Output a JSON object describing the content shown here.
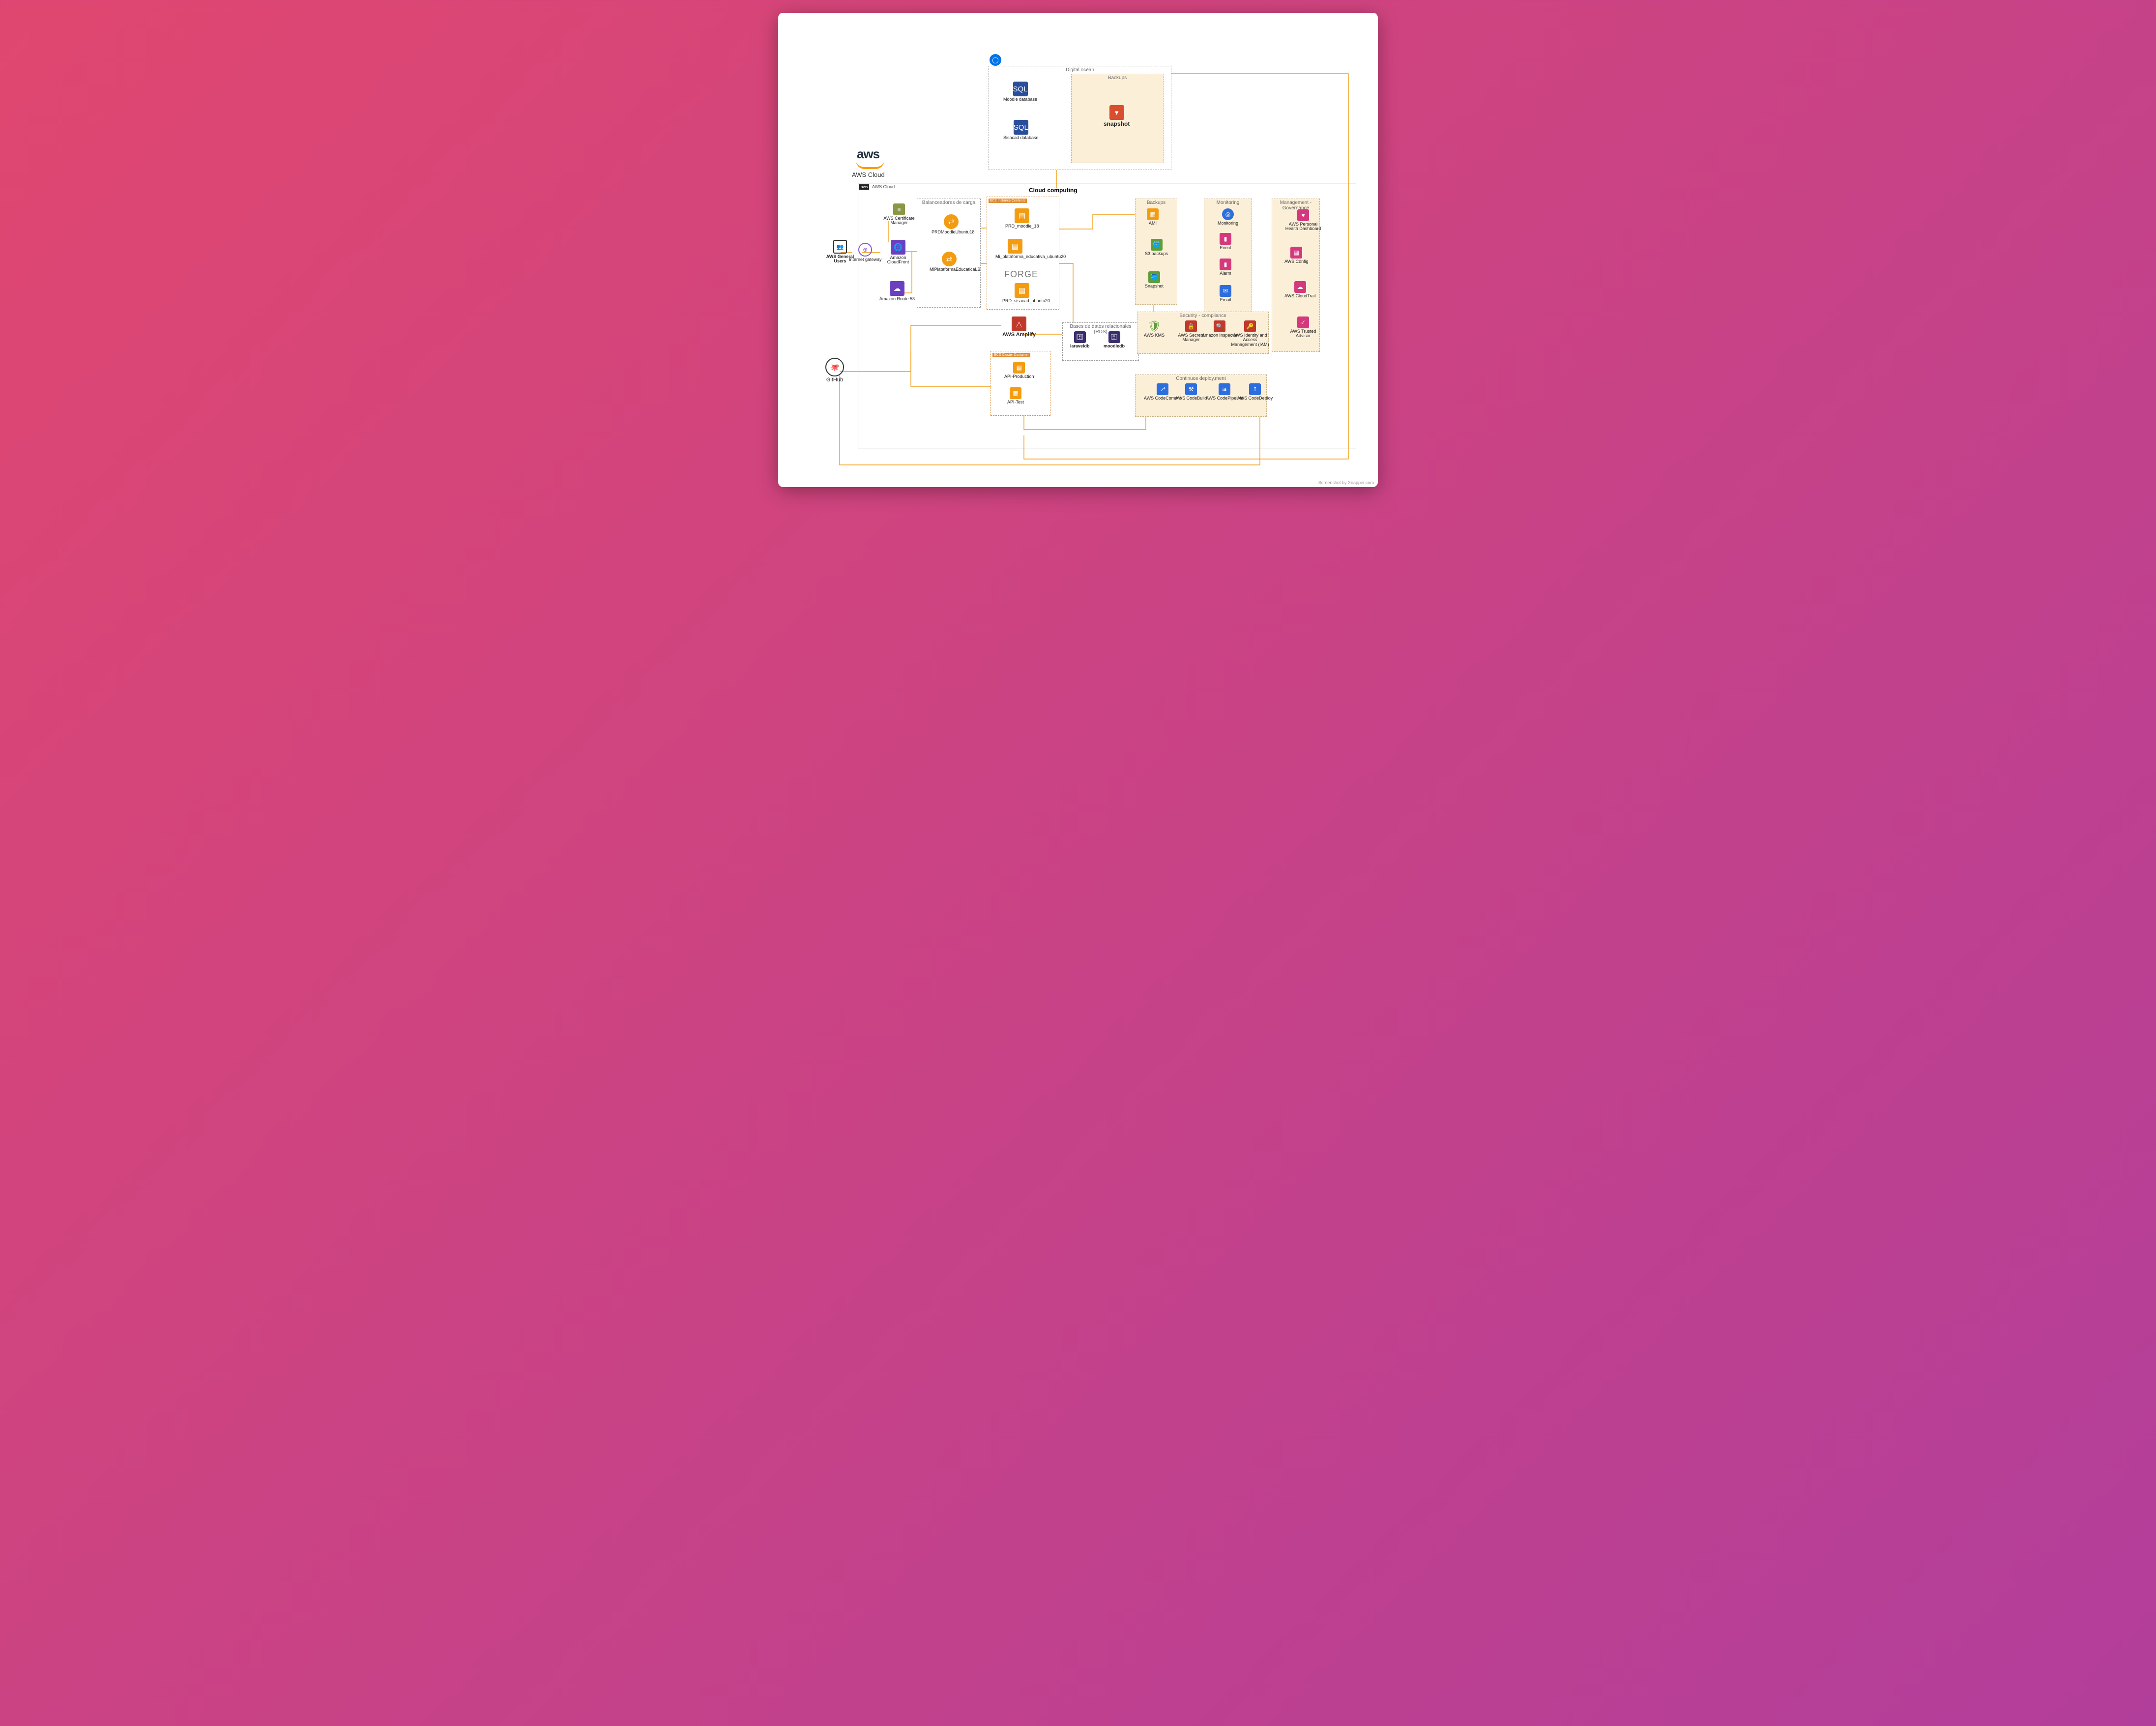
{
  "page_footer": "Screenshot by Xnapper.com",
  "aws_brand": {
    "logo_text": "aws",
    "caption": "AWS Cloud"
  },
  "aws_cloud_box_label": "AWS Cloud",
  "digital_ocean_label": "Digital ocean",
  "do_backups_label": "Backups",
  "do": {
    "moodle": "Moodle database",
    "sisacad": "Sisacad database",
    "snapshot": "snapshot"
  },
  "cloud_computing_label": "Cloud computing",
  "balancers_label": "Balanceadores de carga",
  "balancers": {
    "lb1": "PRDMoodleUbuntu18",
    "lb2": "MiPlataformaEducaticaLB"
  },
  "ec2_box_label": "EC2 Instance Contents",
  "ec2": {
    "i1": "PRD_moodle_18",
    "i2": "Mi_plataforma_educativa_ubuntu20",
    "i3": "PRD_sisacad_ubuntu20",
    "forge": "FORGE"
  },
  "ecs_box_label": "ECS Cluster Container",
  "ecs": {
    "c1": "API-Production",
    "c2": "API-Test"
  },
  "amplify_label": "AWS Amplify",
  "rds_label": "Bases de datos relacionales (RDS)",
  "rds": {
    "db1": "laraveldb",
    "db2": "moodledb"
  },
  "left": {
    "users": "AWS General Users",
    "igw": "Internet gateway",
    "github": "GitHub",
    "acm": "AWS Certificate Manager",
    "cloudfront": "Amazon CloudFront",
    "route53": "Amazon Route 53"
  },
  "backups_aws_label": "Backups",
  "backups": {
    "ami": "AMI",
    "s3": "S3 backups",
    "snap": "Snapshot"
  },
  "monitoring_label": "Monitoring",
  "monitoring": {
    "mon": "Monitoring",
    "event": "Event",
    "alarm": "Alarm",
    "email": "Email"
  },
  "mgmt_label": "Management - Governance",
  "mgmt": {
    "phd": "AWS Personal Health Dashboard",
    "config": "AWS Config",
    "cloudtrail": "AWS CloudTrail",
    "advisor": "AWS Trusted Advisor"
  },
  "security_label": "Security - compliance",
  "security": {
    "kms": "AWS KMS",
    "secrets": "AWS Secrets Manager",
    "inspector": "Amazon Inspector",
    "iam": "AWS Identity and Access Management (IAM)"
  },
  "cd_label": "Continuos deploy,ment",
  "cd": {
    "commit": "AWS CodeCommit",
    "build": "AWS CodeBuild",
    "pipeline": "AWS CodePipeline",
    "deploy": "AWS CodeDeploy"
  }
}
